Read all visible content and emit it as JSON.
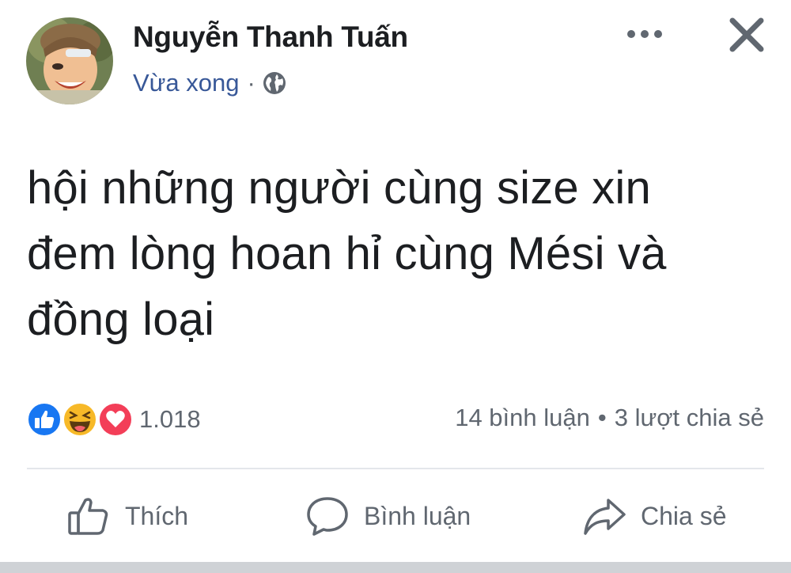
{
  "author": {
    "name": "Nguyễn Thanh Tuấn"
  },
  "meta": {
    "timestamp": "Vừa xong",
    "separator": "·",
    "privacy_icon": "globe-icon"
  },
  "header": {
    "more_icon": "more-options-icon",
    "close_icon": "close-icon"
  },
  "post": {
    "lines": [
      "hội những người cùng size xin",
      "đem lòng hoan hỉ cùng Mési và",
      "đồng loại"
    ]
  },
  "reactions": {
    "icons": [
      "like-reaction-icon",
      "haha-reaction-icon",
      "love-reaction-icon"
    ],
    "count": "1.018",
    "colors": {
      "like": "#1877f2",
      "haha": "#f7b928",
      "love": "#f33e58"
    }
  },
  "stats": {
    "comments": "14 bình luận",
    "separator": "•",
    "shares": "3 lượt chia sẻ"
  },
  "actions": {
    "like": "Thích",
    "comment": "Bình luận",
    "share": "Chia sẻ"
  },
  "colors": {
    "link": "#385898",
    "text": "#1c1e21",
    "muted": "#606770"
  }
}
